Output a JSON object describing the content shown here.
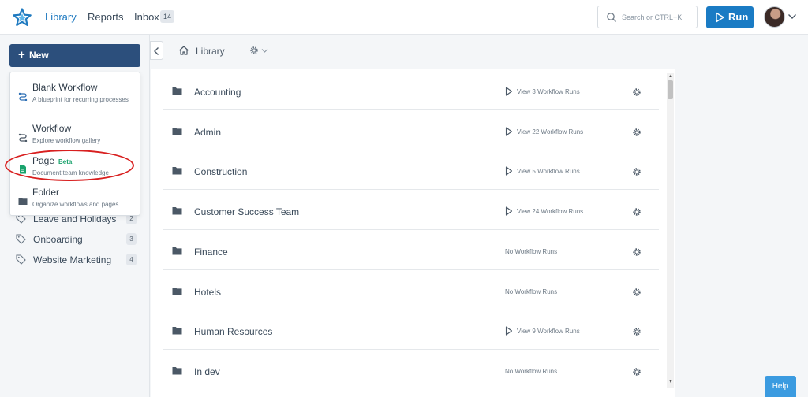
{
  "topbar": {
    "logo_icon": "star-logo-icon",
    "nav": [
      {
        "label": "Library",
        "active": true
      },
      {
        "label": "Reports",
        "active": false
      },
      {
        "label": "Inbox",
        "active": false
      }
    ],
    "inbox_count": "14",
    "search_placeholder": "Search or CTRL+K",
    "run_label": "Run"
  },
  "sidebar": {
    "new_label": "New",
    "dropdown": [
      {
        "title": "Blank Workflow",
        "desc": "A blueprint for recurring processes",
        "icon": "workflow-icon"
      },
      {
        "title": "Workflow",
        "desc": "Explore workflow gallery",
        "icon": "workflow-icon"
      },
      {
        "title": "Page",
        "badge": "Beta",
        "desc": "Document team knowledge",
        "icon": "page-icon"
      },
      {
        "title": "Folder",
        "desc": "Organize workflows and pages",
        "icon": "folder-icon"
      }
    ],
    "tags": [
      {
        "label": "Leave and Holidays",
        "count": "2"
      },
      {
        "label": "Onboarding",
        "count": "3"
      },
      {
        "label": "Website Marketing",
        "count": "4"
      }
    ]
  },
  "breadcrumb": {
    "label": "Library"
  },
  "folders": [
    {
      "name": "Accounting",
      "runs": "View 3 Workflow Runs",
      "has_runs": true
    },
    {
      "name": "Admin",
      "runs": "View 22 Workflow Runs",
      "has_runs": true
    },
    {
      "name": "Construction",
      "runs": "View 5 Workflow Runs",
      "has_runs": true
    },
    {
      "name": "Customer Success Team",
      "runs": "View 24 Workflow Runs",
      "has_runs": true
    },
    {
      "name": "Finance",
      "runs": "No Workflow Runs",
      "has_runs": false
    },
    {
      "name": "Hotels",
      "runs": "No Workflow Runs",
      "has_runs": false
    },
    {
      "name": "Human Resources",
      "runs": "View 9 Workflow Runs",
      "has_runs": true
    },
    {
      "name": "In dev",
      "runs": "No Workflow Runs",
      "has_runs": false
    }
  ],
  "help_label": "Help",
  "colors": {
    "primary": "#1a7bc4",
    "new_button": "#2c4f7c",
    "highlight": "#d81f1f",
    "beta": "#1aa36d"
  }
}
